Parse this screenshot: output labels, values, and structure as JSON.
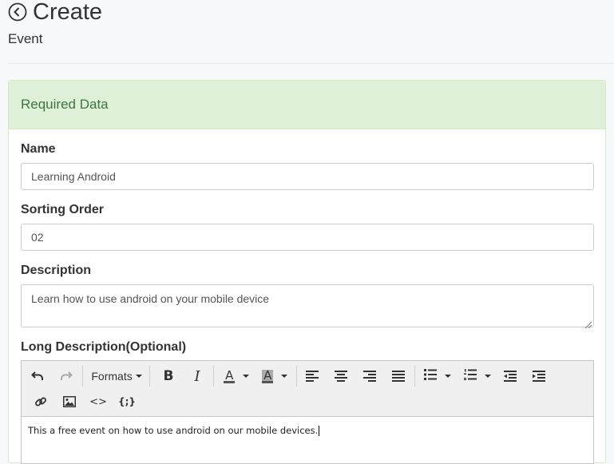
{
  "page": {
    "title": "Create",
    "subtitle": "Event"
  },
  "panel": {
    "heading": "Required Data",
    "heading_color": "#3c763d",
    "heading_bg": "#dff0d8"
  },
  "form": {
    "name_label": "Name",
    "name_value": "Learning Android",
    "sorting_label": "Sorting Order",
    "sorting_value": "02",
    "description_label": "Description",
    "description_value": "Learn how to use android on your mobile device",
    "long_description_label": "Long Description(Optional)"
  },
  "editor": {
    "formats_label": "Formats",
    "toolbar_icons": [
      "undo-icon",
      "redo-icon",
      "bold-icon",
      "italic-icon",
      "text-color-icon",
      "background-color-icon",
      "align-left-icon",
      "align-center-icon",
      "align-right-icon",
      "align-justify-icon",
      "bullet-list-icon",
      "numbered-list-icon",
      "outdent-icon",
      "indent-icon",
      "link-icon",
      "image-icon",
      "code-icon",
      "template-icon"
    ],
    "bold_glyph": "B",
    "italic_glyph": "I",
    "color_glyph": "A",
    "code_glyph": "<>",
    "template_glyph": "{;}",
    "content": "This a free event on how to use android on our mobile devices."
  }
}
